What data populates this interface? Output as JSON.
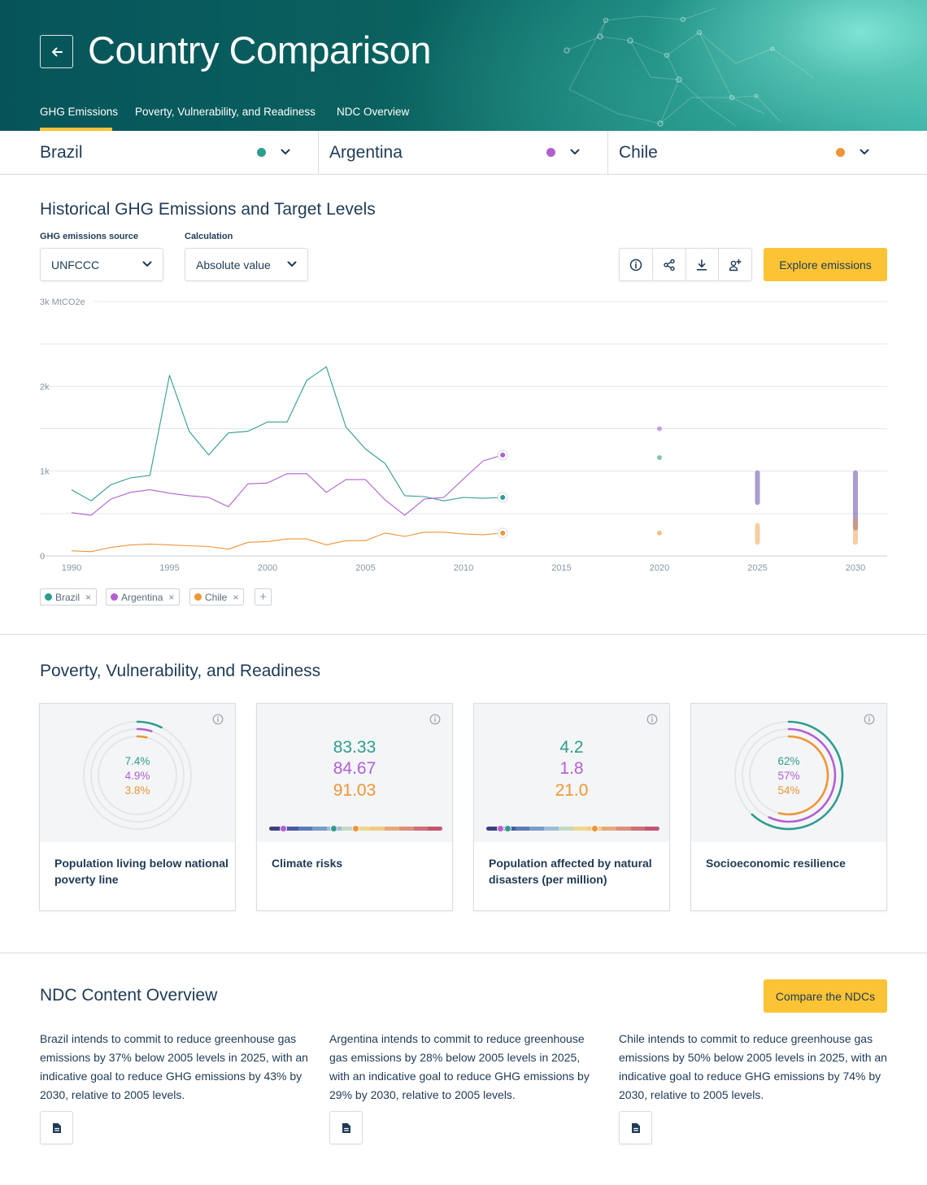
{
  "header": {
    "title": "Country Comparison",
    "back_icon": "arrow-left-icon",
    "tabs": [
      {
        "label": "GHG Emissions",
        "active": true
      },
      {
        "label": "Poverty, Vulnerability, and Readiness",
        "active": false
      },
      {
        "label": "NDC Overview",
        "active": false
      }
    ]
  },
  "countries": [
    {
      "name": "Brazil",
      "color": "#2e9d8f"
    },
    {
      "name": "Argentina",
      "color": "#b35fd2"
    },
    {
      "name": "Chile",
      "color": "#ee9536"
    }
  ],
  "emissions": {
    "title": "Historical GHG Emissions and Target Levels",
    "source_label": "GHG emissions source",
    "source_value": "UNFCCC",
    "calc_label": "Calculation",
    "calc_value": "Absolute value",
    "toolbar_icons": [
      "info-icon",
      "share-icon",
      "download-icon",
      "add-user-icon"
    ],
    "explore_label": "Explore emissions",
    "legend": [
      {
        "name": "Brazil",
        "color": "#2e9d8f"
      },
      {
        "name": "Argentina",
        "color": "#b35fd2"
      },
      {
        "name": "Chile",
        "color": "#ee9536"
      }
    ]
  },
  "chart_data": {
    "type": "line",
    "unit_label": "3k MtCO2e",
    "y_tick_labels": [
      "0",
      "1k",
      "2k"
    ],
    "x_tick_labels": [
      "1990",
      "1995",
      "2000",
      "2005",
      "2010",
      "2015",
      "2020",
      "2025",
      "2030"
    ],
    "ylim": [
      0,
      3000
    ],
    "xlim": [
      1989.5,
      2031.5
    ],
    "x": [
      1990,
      1991,
      1992,
      1993,
      1994,
      1995,
      1996,
      1997,
      1998,
      1999,
      2000,
      2001,
      2002,
      2003,
      2004,
      2005,
      2006,
      2007,
      2008,
      2009,
      2010,
      2011,
      2012
    ],
    "series": [
      {
        "name": "Brazil",
        "color": "#2e9d8f",
        "values": [
          780,
          650,
          840,
          920,
          950,
          2130,
          1470,
          1190,
          1450,
          1470,
          1580,
          1580,
          2070,
          2230,
          1520,
          1260,
          1090,
          710,
          700,
          650,
          690,
          680,
          690
        ],
        "targets": [
          {
            "x": 2020,
            "y": 1160
          },
          {
            "x": 2025,
            "low": 630,
            "high": 980
          },
          {
            "x": 2030,
            "low": 330,
            "high": 980
          }
        ]
      },
      {
        "name": "Argentina",
        "color": "#b35fd2",
        "values": [
          510,
          480,
          670,
          750,
          780,
          740,
          710,
          690,
          580,
          850,
          860,
          970,
          970,
          750,
          900,
          900,
          660,
          480,
          670,
          690,
          910,
          1120,
          1190
        ],
        "targets": [
          {
            "x": 2020,
            "y": 1500
          },
          {
            "x": 2025,
            "low": 630,
            "high": 980
          },
          {
            "x": 2030,
            "low": 330,
            "high": 980
          }
        ]
      },
      {
        "name": "Chile",
        "color": "#ee9536",
        "values": [
          60,
          50,
          100,
          130,
          140,
          130,
          120,
          110,
          80,
          160,
          170,
          200,
          200,
          130,
          180,
          180,
          270,
          230,
          280,
          280,
          260,
          250,
          270
        ],
        "targets": [
          {
            "x": 2020,
            "y": 270
          },
          {
            "x": 2025,
            "low": 160,
            "high": 360
          },
          {
            "x": 2030,
            "low": 160,
            "high": 420
          }
        ]
      }
    ],
    "grid": true
  },
  "pvr": {
    "title": "Poverty, Vulnerability, and Readiness",
    "cards": [
      {
        "title": "Population living below national poverty line",
        "values": [
          "7.4%",
          "4.9%",
          "3.8%"
        ],
        "fractions": [
          0.074,
          0.049,
          0.038
        ],
        "info_icon": "info-icon"
      },
      {
        "title": "Climate risks",
        "values": [
          "83.33",
          "84.67",
          "91.03"
        ],
        "info_icon": "info-icon"
      },
      {
        "title": "Population affected by natural disasters (per million)",
        "values": [
          "4.2",
          "1.8",
          "21.0"
        ],
        "info_icon": "info-icon"
      },
      {
        "title": "Socioeconomic resilience",
        "values": [
          "62%",
          "57%",
          "54%"
        ],
        "fractions": [
          0.62,
          0.57,
          0.54
        ],
        "info_icon": "info-icon"
      }
    ],
    "strip_colors": [
      "#3e3f80",
      "#4a5aa0",
      "#5d7cb8",
      "#7a9cc9",
      "#9fbed8",
      "#c6d9c3",
      "#eed88f",
      "#f3c986",
      "#e6a97a",
      "#dc8f7a",
      "#cf6f79",
      "#c55472"
    ]
  },
  "ndc": {
    "title": "NDC Content Overview",
    "compare_label": "Compare the NDCs",
    "texts": [
      "Brazil intends to commit to reduce greenhouse gas emissions by 37% below 2005 levels in 2025, with an indicative goal to reduce GHG emissions by 43% by 2030, relative to 2005 levels.",
      "Argentina intends to commit to reduce greenhouse gas emissions by 28% below 2005 levels in 2025, with an indicative goal to reduce GHG emissions by 29% by 2030, relative to 2005 levels.",
      "Chile intends to commit to reduce greenhouse gas emissions by 50% below 2005 levels in 2025, with an indicative goal to reduce GHG emissions by 74% by 2030, relative to 2005 levels."
    ],
    "doc_icon": "document-icon"
  }
}
